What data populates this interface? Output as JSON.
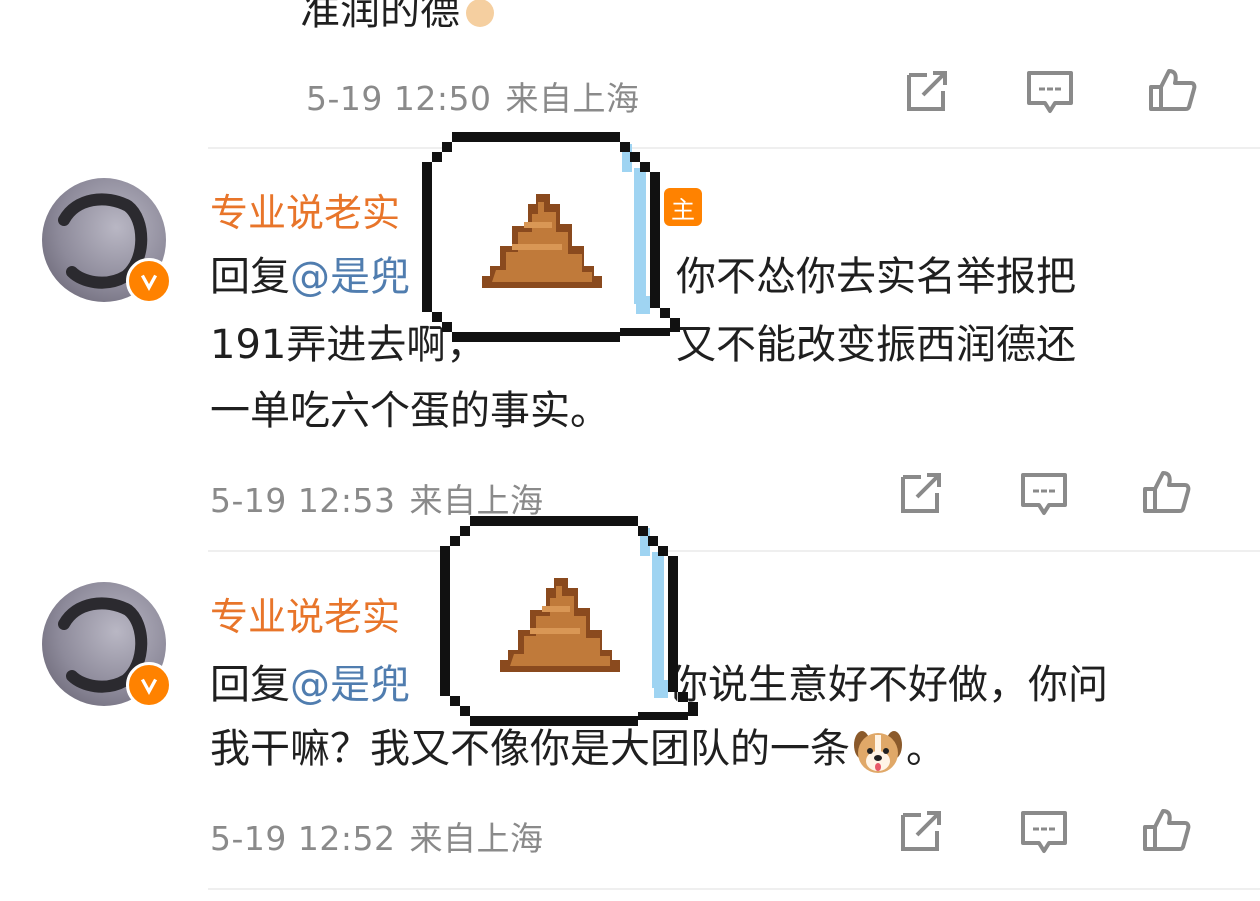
{
  "top": {
    "truncated_text": "准润的德",
    "time": "5-19 12:50",
    "source": "来自上海"
  },
  "comments": [
    {
      "username": "专业说老实",
      "badge": "主",
      "line1_prefix": "回复",
      "mention": "@是兜",
      "line1_suffix": "你不怂你去实名举报把",
      "line2": "191弄进去啊，",
      "line2_suffix": "又不能改变振西润德还",
      "line3": "一单吃六个蛋的事实。",
      "time": "5-19 12:53",
      "source": "来自上海"
    },
    {
      "username": "专业说老实",
      "badge": "",
      "line1_prefix": "回复",
      "mention": "@是兜",
      "line1_suffix": "你说生意好不好做，你问",
      "line2": "我干嘛？我又不像你是大团队的一条",
      "line2_emoji": "dog-face",
      "line2_end": "。",
      "time": "5-19 12:52",
      "source": "来自上海"
    }
  ],
  "icons": {
    "share": "share-icon",
    "comment": "comment-icon",
    "like": "like-icon",
    "sticker": "poop-sticker"
  },
  "colors": {
    "username": "#e8752a",
    "mention": "#507daf",
    "meta": "#8a8a8a",
    "verified": "#ff8200"
  }
}
